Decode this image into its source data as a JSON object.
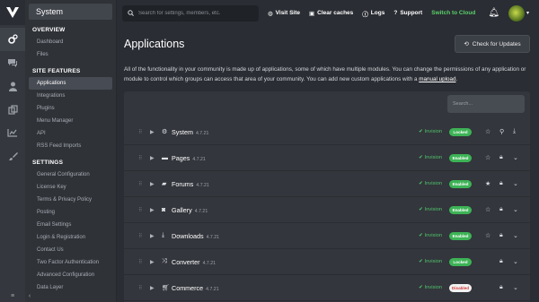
{
  "header": {
    "search_placeholder": "Search for settings, members, etc.",
    "links": [
      {
        "label": "Visit Site",
        "icon": "globe-icon"
      },
      {
        "label": "Clear caches",
        "icon": "trash-icon"
      },
      {
        "label": "Logs",
        "icon": "info-icon"
      },
      {
        "label": "Support",
        "icon": "help-icon"
      },
      {
        "label": "Switch to Cloud",
        "icon": ""
      }
    ]
  },
  "sidebar": {
    "title": "System",
    "sections": [
      {
        "heading": "OVERVIEW",
        "items": [
          "Dashboard",
          "Files"
        ]
      },
      {
        "heading": "SITE FEATURES",
        "items": [
          "Applications",
          "Integrations",
          "Plugins",
          "Menu Manager",
          "API",
          "RSS Feed Imports"
        ]
      },
      {
        "heading": "SETTINGS",
        "items": [
          "General Configuration",
          "License Key",
          "Terms & Privacy Policy",
          "Posting",
          "Email Settings",
          "Login & Registration",
          "Contact Us",
          "Two Factor Authentication",
          "Advanced Configuration",
          "Data Layer"
        ]
      }
    ]
  },
  "main": {
    "title": "Applications",
    "check_updates": "Check for Updates",
    "description_1": "All of the functionality in your community is made up of applications, some of which have multiple modules. You can change the permissions of any application or module to control which groups can access that area of your community. You can add new custom applications with a ",
    "description_link": "manual upload",
    "description_2": ".",
    "panel_search_placeholder": "Search...",
    "apps": [
      {
        "name": "System",
        "version": "4.7.21",
        "icon": "gears-icon",
        "status": "Invision",
        "badge": "Locked",
        "badge_color": "green",
        "actions": [
          "star-icon",
          "search-icon",
          "download-icon"
        ]
      },
      {
        "name": "Pages",
        "version": "4.7.21",
        "icon": "folder-icon",
        "status": "Invision",
        "badge": "Enabled",
        "badge_color": "green",
        "actions": [
          "star-icon",
          "lock-icon",
          "chevron-down-icon"
        ]
      },
      {
        "name": "Forums",
        "version": "4.7.21",
        "icon": "comments-icon",
        "status": "Invision",
        "badge": "Enabled",
        "badge_color": "green",
        "actions": [
          "star-filled-icon",
          "lock-icon",
          "chevron-down-icon"
        ]
      },
      {
        "name": "Gallery",
        "version": "4.7.21",
        "icon": "camera-icon",
        "status": "Invision",
        "badge": "Enabled",
        "badge_color": "green",
        "actions": [
          "star-icon",
          "lock-icon",
          "chevron-down-icon"
        ]
      },
      {
        "name": "Downloads",
        "version": "4.7.21",
        "icon": "download-icon",
        "status": "Invision",
        "badge": "Enabled",
        "badge_color": "green",
        "actions": [
          "star-icon",
          "lock-icon",
          "chevron-down-icon"
        ]
      },
      {
        "name": "Converter",
        "version": "4.7.21",
        "icon": "shuffle-icon",
        "status": "Invision",
        "badge": "Locked",
        "badge_color": "green",
        "actions": [
          "lock-icon",
          "chevron-down-icon"
        ]
      },
      {
        "name": "Commerce",
        "version": "4.7.21",
        "icon": "cart-icon",
        "status": "Invision",
        "badge": "Disabled",
        "badge_color": "red",
        "actions": [
          "lock-icon",
          "chevron-down-icon"
        ]
      }
    ]
  }
}
